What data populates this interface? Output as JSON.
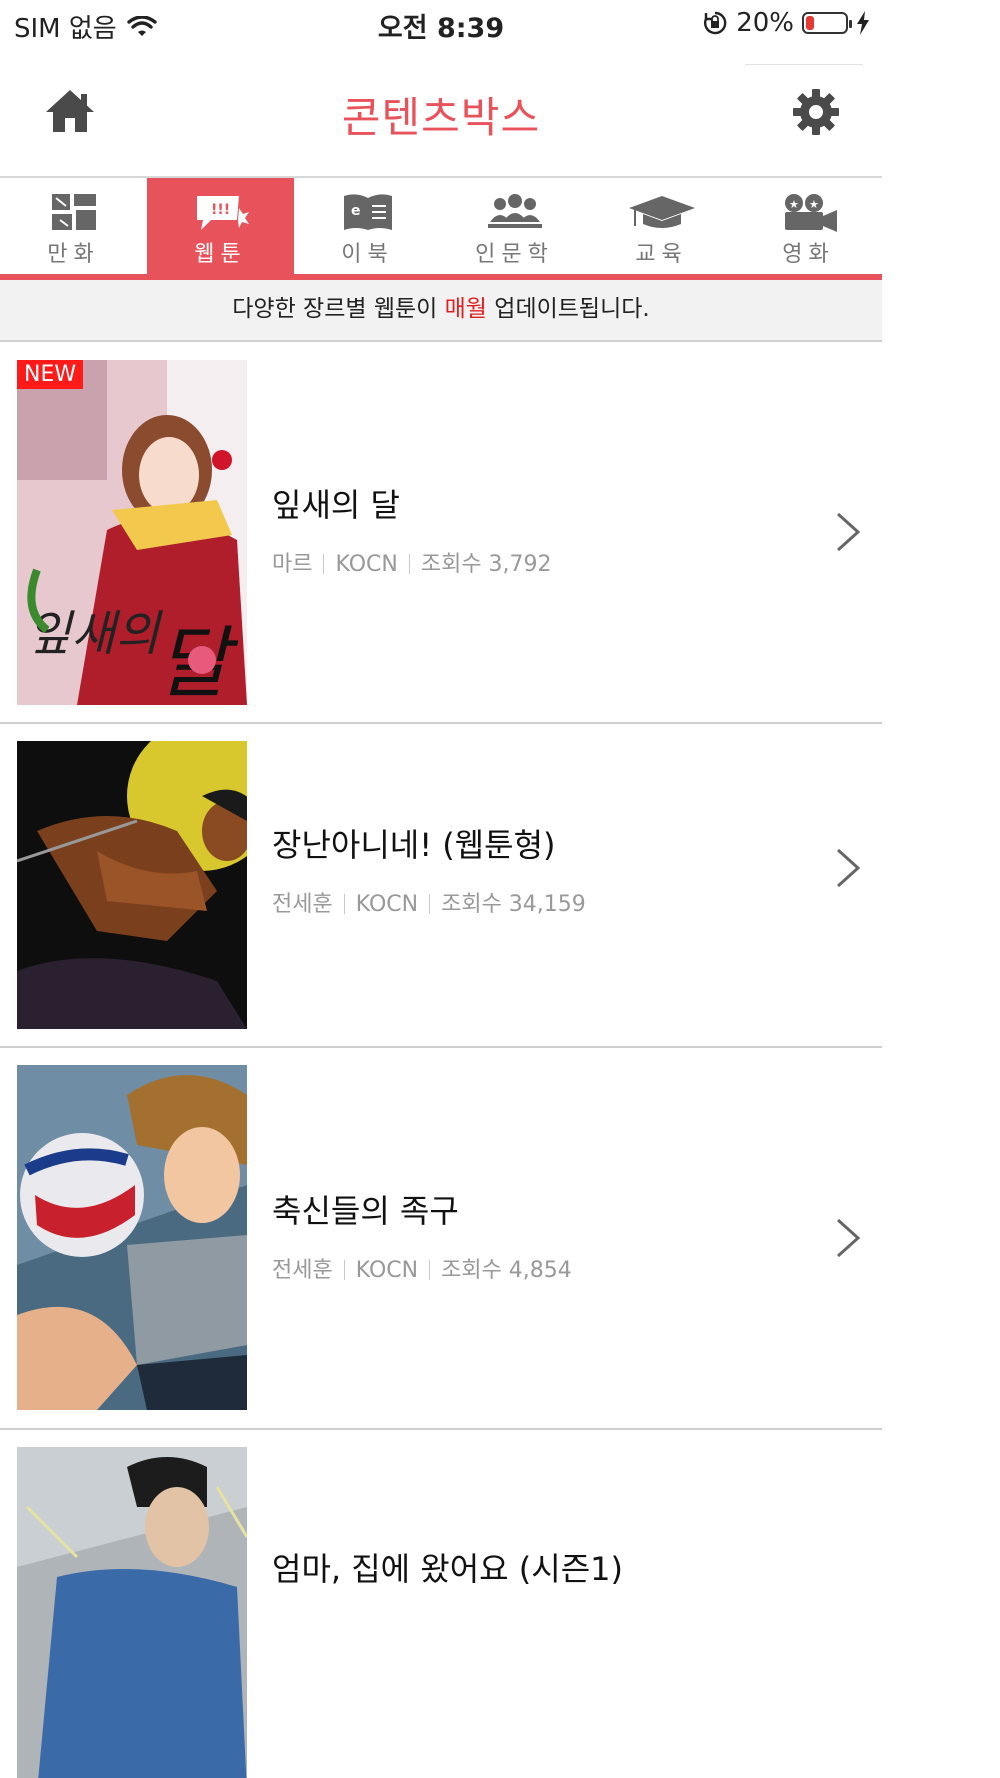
{
  "status_bar": {
    "carrier": "SIM 없음",
    "time": "오전 8:39",
    "battery_text": "20%",
    "battery_level": 0.2
  },
  "header": {
    "title": "콘텐츠박스",
    "home_icon": "home-icon",
    "settings_icon": "gear-icon"
  },
  "tabs": [
    {
      "label": "만화",
      "icon": "comic-icon",
      "active": false
    },
    {
      "label": "웹툰",
      "icon": "webtoon-icon",
      "active": true
    },
    {
      "label": "이북",
      "icon": "ebook-icon",
      "active": false
    },
    {
      "label": "인문학",
      "icon": "people-icon",
      "active": false
    },
    {
      "label": "교육",
      "icon": "graduation-cap-icon",
      "active": false
    },
    {
      "label": "영화",
      "icon": "movie-camera-icon",
      "active": false
    }
  ],
  "notice": {
    "before": "다양한 장르별 웹툰이 ",
    "highlight": "매월",
    "after": " 업데이트됩니다."
  },
  "items": [
    {
      "title": "잎새의 달",
      "author": "마르",
      "publisher": "KOCN",
      "views": "조회수 3,792",
      "badge": "NEW"
    },
    {
      "title": "장난아니네! (웹툰형)",
      "author": "전세훈",
      "publisher": "KOCN",
      "views": "조회수 34,159",
      "badge": ""
    },
    {
      "title": "축신들의 족구",
      "author": "전세훈",
      "publisher": "KOCN",
      "views": "조회수 4,854",
      "badge": ""
    },
    {
      "title": "엄마, 집에 왔어요 (시즌1)",
      "author": "",
      "publisher": "",
      "views": "",
      "badge": ""
    }
  ],
  "colors": {
    "accent": "#e8525a",
    "highlight": "#e02020",
    "badge": "#ff1a1a"
  }
}
